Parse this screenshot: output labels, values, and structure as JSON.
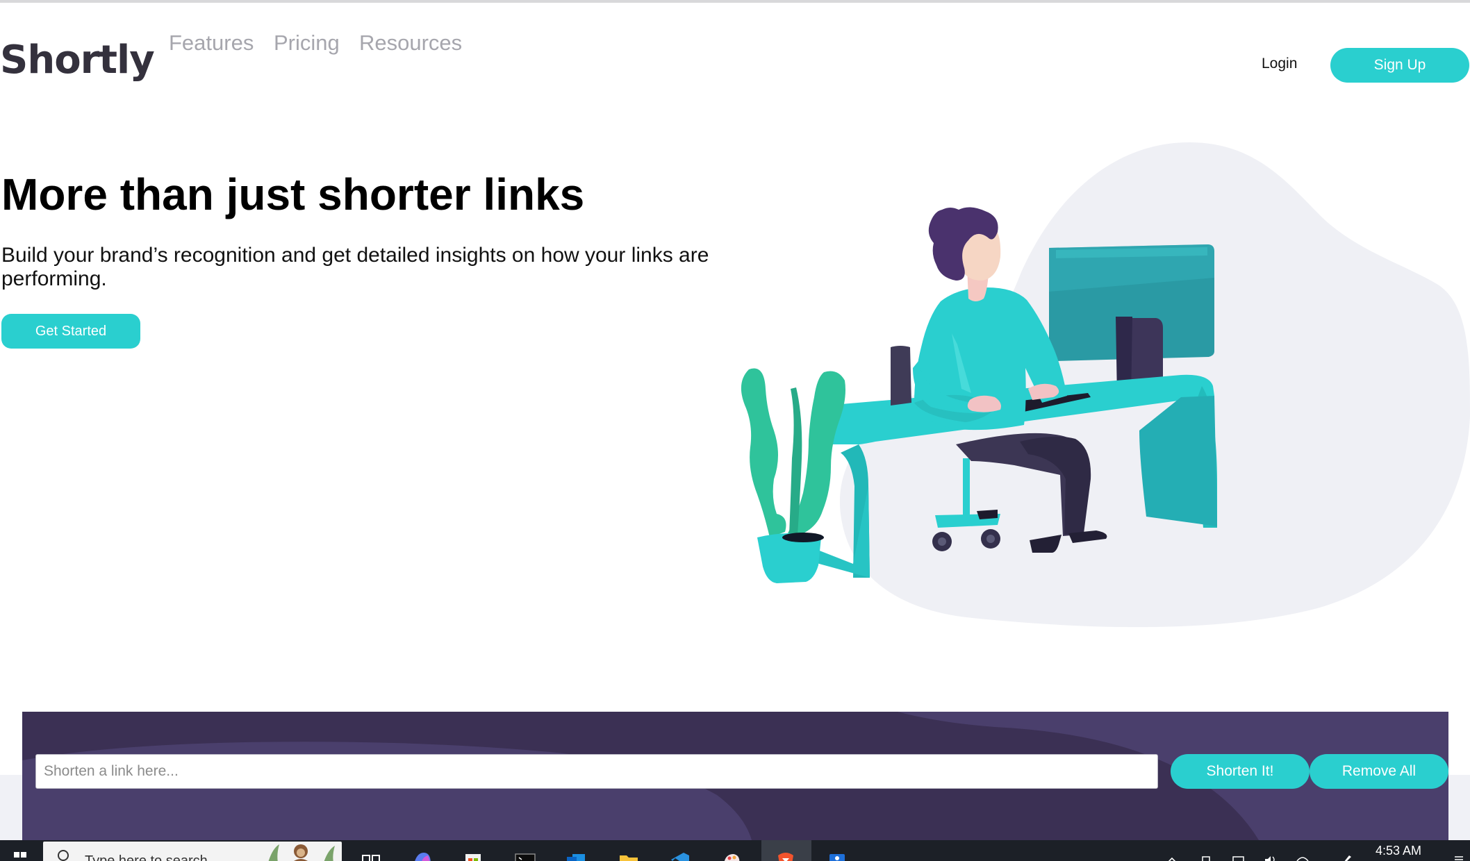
{
  "header": {
    "logo": "Shortly",
    "nav": [
      {
        "label": "Features"
      },
      {
        "label": "Pricing"
      },
      {
        "label": "Resources"
      }
    ],
    "login_label": "Login",
    "signup_label": "Sign Up"
  },
  "hero": {
    "title": "More than just shorter links",
    "subtitle": "Build your brand’s recognition and get detailed insights on how your links are performing.",
    "cta_label": "Get Started",
    "illustration_icon": "person-working-at-desk-illustration"
  },
  "shorten": {
    "input_placeholder": "Shorten a link here...",
    "input_value": "",
    "shorten_label": "Shorten It!",
    "remove_label": "Remove All"
  },
  "taskbar": {
    "search_placeholder": "Type here to search",
    "time": "4:53 AM",
    "apps": [
      "task-view-icon",
      "copilot-icon",
      "store-icon",
      "terminal-icon",
      "outlook-icon",
      "file-explorer-icon",
      "vscode-icon",
      "paint-icon",
      "brave-icon",
      "app-icon"
    ]
  },
  "colors": {
    "accent": "#2acfcf",
    "dark_violet": "#3b3054",
    "gray_text": "#a6a6ad",
    "logo": "#34313d"
  }
}
